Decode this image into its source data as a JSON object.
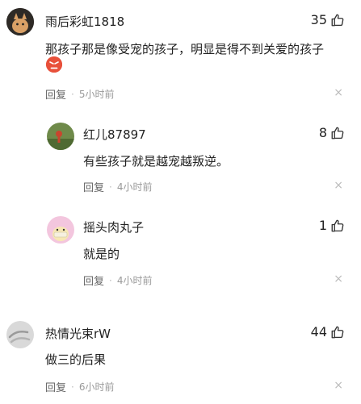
{
  "comments": [
    {
      "username": "雨后彩虹1818",
      "likes": "35",
      "text": "那孩子那是像受宠的孩子，明显是得不到关爱的孩子",
      "reply_label": "回复",
      "dot": "·",
      "time": "5小时前",
      "close": "×"
    },
    {
      "username": "红儿87897",
      "likes": "8",
      "text": "有些孩子就是越宠越叛逆。",
      "reply_label": "回复",
      "dot": "·",
      "time": "4小时前",
      "close": "×"
    },
    {
      "username": "摇头肉丸子",
      "likes": "1",
      "text": "就是的",
      "reply_label": "回复",
      "dot": "·",
      "time": "4小时前",
      "close": "×"
    },
    {
      "username": "热情光束rW",
      "likes": "44",
      "text": "做三的后果",
      "reply_label": "回复",
      "dot": "·",
      "time": "6小时前",
      "close": "×"
    }
  ],
  "colors": {
    "text": "#222222",
    "meta": "#999999",
    "emoji": "#e8503a"
  }
}
